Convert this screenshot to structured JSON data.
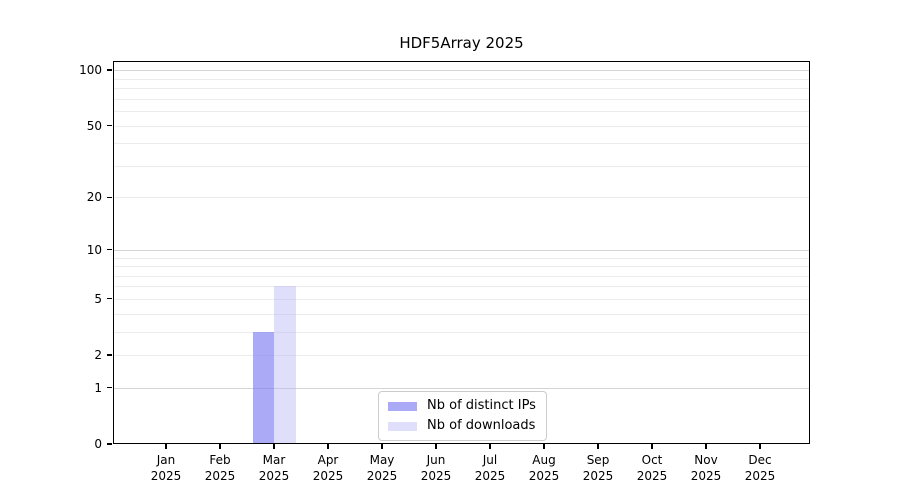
{
  "title": "HDF5Array 2025",
  "chart_data": {
    "type": "bar",
    "title": "HDF5Array 2025",
    "categories": [
      "Jan 2025",
      "Feb 2025",
      "Mar 2025",
      "Apr 2025",
      "May 2025",
      "Jun 2025",
      "Jul 2025",
      "Aug 2025",
      "Sep 2025",
      "Oct 2025",
      "Nov 2025",
      "Dec 2025"
    ],
    "x_months": [
      "Jan",
      "Feb",
      "Mar",
      "Apr",
      "May",
      "Jun",
      "Jul",
      "Aug",
      "Sep",
      "Oct",
      "Nov",
      "Dec"
    ],
    "x_year": "2025",
    "series": [
      {
        "name": "Nb of distinct IPs",
        "color": "#7e7ef1",
        "opacity": 0.66,
        "apparent_color": "#aaaaf6",
        "values": [
          0,
          0,
          3,
          0,
          0,
          0,
          0,
          0,
          0,
          0,
          0,
          0
        ]
      },
      {
        "name": "Nb of downloads",
        "color": "#b7b7f7",
        "opacity": 0.45,
        "apparent_color": "#dedefb",
        "values": [
          0,
          0,
          6,
          0,
          0,
          0,
          0,
          0,
          0,
          0,
          0,
          0
        ]
      }
    ],
    "xlabel": "",
    "ylabel": "",
    "yscale": "log1p",
    "ylim": [
      0,
      112
    ],
    "ytick_values": [
      0,
      1,
      2,
      5,
      10,
      20,
      50,
      100
    ],
    "ytick_labels": [
      "0",
      "1",
      "2",
      "5",
      "10",
      "20",
      "50",
      "100"
    ],
    "minor_grid_values": [
      2,
      3,
      4,
      5,
      6,
      7,
      8,
      9,
      20,
      30,
      40,
      50,
      60,
      70,
      80,
      90
    ],
    "major_grid_values": [
      1,
      10,
      100
    ],
    "grid": "horizontal",
    "legend_position": "inside-bottom-center",
    "background_color": "#ffffff",
    "spine_color": "#000000"
  },
  "legend": {
    "items": [
      {
        "label": "Nb of distinct IPs",
        "color": "#aaaaf6"
      },
      {
        "label": "Nb of downloads",
        "color": "#dedefb"
      }
    ]
  }
}
